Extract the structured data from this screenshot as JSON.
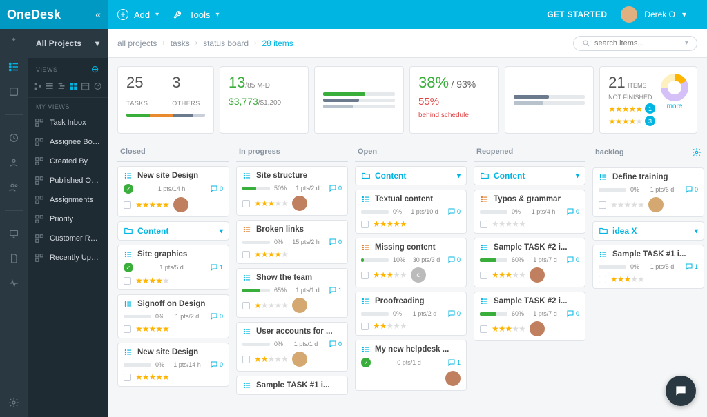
{
  "header": {
    "brand": "OneDesk",
    "add": "Add",
    "tools": "Tools",
    "get_started": "GET STARTED",
    "user": "Derek O"
  },
  "sidebar": {
    "title": "All Projects",
    "views_label": "VIEWS",
    "myviews_label": "MY VIEWS",
    "items": [
      {
        "label": "Task Inbox"
      },
      {
        "label": "Assignee Board"
      },
      {
        "label": "Created By"
      },
      {
        "label": "Published On P..."
      },
      {
        "label": "Assignments"
      },
      {
        "label": "Priority"
      },
      {
        "label": "Customer Req..."
      },
      {
        "label": "Recently Upda..."
      }
    ]
  },
  "breadcrumbs": [
    {
      "label": "all projects"
    },
    {
      "label": "tasks"
    },
    {
      "label": "status board"
    },
    {
      "label": "28 items",
      "active": true
    }
  ],
  "search_placeholder": "search items...",
  "stats": {
    "tasks_count": "25",
    "tasks_label": "TASKS",
    "others_count": "3",
    "others_label": "OTHERS",
    "md_num": "13",
    "md_den": "/85 M-D",
    "money_num": "$3,773",
    "money_den": "/$1,200",
    "pct_main": "38%",
    "pct_sub": "/ 93%",
    "pct_red": "55%",
    "pct_red_label": "behind schedule",
    "items_num": "21",
    "items_l1": "ITEMS",
    "items_l2": "NOT FINISHED",
    "badge1": "1",
    "badge2": "3",
    "more": "more"
  },
  "columns": [
    {
      "title": "Closed",
      "cards": [
        {
          "type": "task",
          "title": "New site Design",
          "done": true,
          "pts": "1 pts/14 h",
          "cm": 0,
          "stars": 5,
          "av": "f1"
        },
        {
          "type": "group",
          "title": "Content",
          "color": "blue"
        },
        {
          "type": "task",
          "title": "Site graphics",
          "done": true,
          "pts": "1 pts/5 d",
          "cm": 1,
          "stars": 4
        },
        {
          "type": "task",
          "title": "Signoff on Design",
          "progress": 0,
          "pct": "0%",
          "pts": "1 pts/2 d",
          "cm": 0,
          "stars": 5
        },
        {
          "type": "task",
          "title": "New site Design",
          "progress": 0,
          "pct": "0%",
          "pts": "1 pts/14 h",
          "cm": 0,
          "stars": 5
        }
      ]
    },
    {
      "title": "In progress",
      "cards": [
        {
          "type": "task",
          "title": "Site structure",
          "progress": 50,
          "pct": "50%",
          "color": "#3aae3a",
          "pts": "1 pts/2 d",
          "cm": 0,
          "stars": 3,
          "av": "f1"
        },
        {
          "type": "task",
          "title": "Broken links",
          "orange": true,
          "progress": 0,
          "pct": "0%",
          "pts": "15 pts/2 h",
          "cm": 0,
          "stars": 4
        },
        {
          "type": "task",
          "title": "Show the team",
          "progress": 65,
          "pct": "65%",
          "color": "#3aae3a",
          "pts": "1 pts/1 d",
          "cm": 1,
          "stars": 1,
          "av": "f2"
        },
        {
          "type": "task",
          "title": "User accounts for ...",
          "progress": 0,
          "pct": "0%",
          "pts": "1 pts/1 d",
          "cm": 0,
          "stars": 2,
          "av": "f2"
        },
        {
          "type": "task",
          "title": "Sample TASK #1 i..."
        }
      ]
    },
    {
      "title": "Open",
      "cards": [
        {
          "type": "group",
          "title": "Content",
          "color": "blue"
        },
        {
          "type": "task",
          "title": "Textual content",
          "progress": 0,
          "pct": "0%",
          "pts": "1 pts/10 d",
          "cm": 0,
          "stars": 5
        },
        {
          "type": "task",
          "title": "Missing content",
          "orange": true,
          "progress": 10,
          "pct": "10%",
          "color": "#3aae3a",
          "pts": "30 pts/3 d",
          "cm": 0,
          "stars": 3,
          "av": "c"
        },
        {
          "type": "task",
          "title": "Proofreading",
          "progress": 0,
          "pct": "0%",
          "pts": "1 pts/2 d",
          "cm": 0,
          "stars": 2
        },
        {
          "type": "task",
          "title": "My new helpdesk ...",
          "done": true,
          "pts": "0 pts/1 d",
          "cm": 1,
          "av": "f1"
        }
      ]
    },
    {
      "title": "Reopened",
      "cards": [
        {
          "type": "group",
          "title": "Content",
          "color": "blue"
        },
        {
          "type": "task",
          "title": "Typos & grammar",
          "orange": true,
          "progress": 0,
          "pct": "0%",
          "pts": "1 pts/4 h",
          "cm": 0,
          "stars": 0
        },
        {
          "type": "task",
          "title": "Sample TASK #2 i...",
          "progress": 60,
          "pct": "60%",
          "color": "#3aae3a",
          "pts": "1 pts/7 d",
          "cm": 0,
          "stars": 3,
          "av": "f1"
        },
        {
          "type": "task",
          "title": "Sample TASK #2 i...",
          "progress": 60,
          "pct": "60%",
          "color": "#3aae3a",
          "pts": "1 pts/7 d",
          "cm": 0,
          "stars": 3,
          "av": "f1"
        }
      ]
    },
    {
      "title": "backlog",
      "gear": true,
      "cards": [
        {
          "type": "task",
          "title": "Define training",
          "progress": 0,
          "pct": "0%",
          "pts": "1 pts/6 d",
          "cm": 0,
          "stars": 0,
          "av": "f2"
        },
        {
          "type": "group",
          "title": "idea X",
          "color": "blue"
        },
        {
          "type": "task",
          "title": "Sample TASK #1 i...",
          "progress": 0,
          "pct": "0%",
          "pts": "1 pts/5 d",
          "cm": 1,
          "stars": 3
        }
      ]
    }
  ]
}
